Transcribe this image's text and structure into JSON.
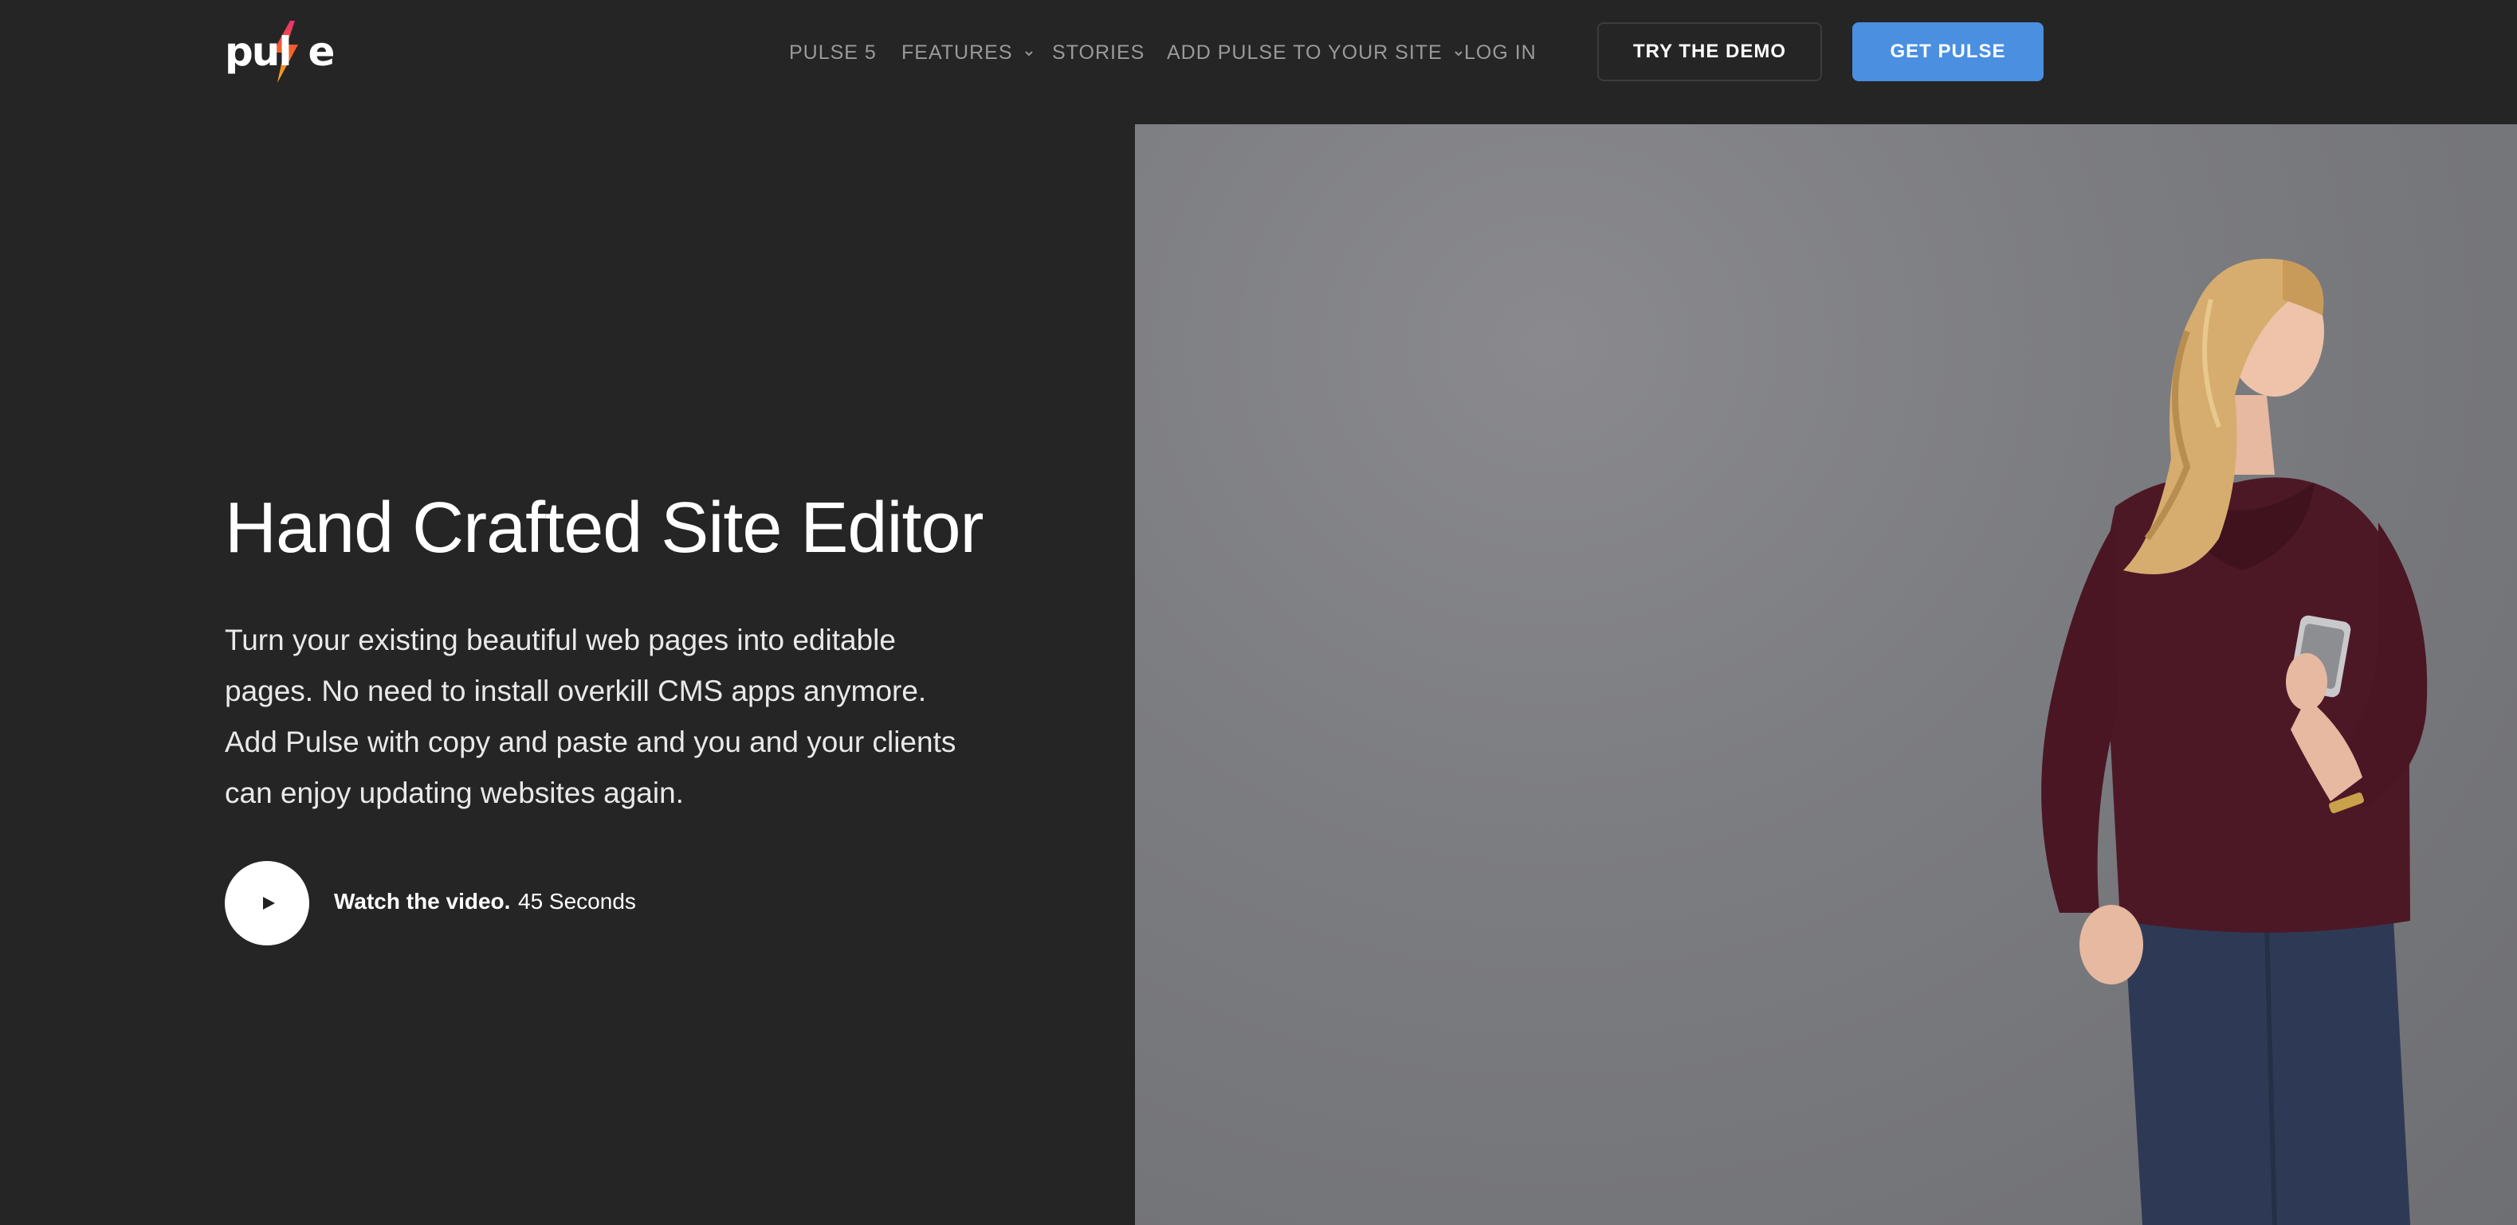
{
  "header": {
    "logo_text": "pulse",
    "nav": [
      {
        "label": "PULSE 5",
        "has_dropdown": false
      },
      {
        "label": "FEATURES",
        "has_dropdown": true
      },
      {
        "label": "STORIES",
        "has_dropdown": false
      },
      {
        "label": "ADD PULSE TO YOUR SITE",
        "has_dropdown": true
      },
      {
        "label": "LOG IN",
        "has_dropdown": false
      }
    ],
    "try_demo_label": "TRY THE DEMO",
    "get_pulse_label": "GET PULSE"
  },
  "hero": {
    "title": "Hand Crafted Site Editor",
    "description": "Turn your existing beautiful web pages into editable pages. No need to install overkill CMS apps anymore. Add Pulse with copy and paste and you and your clients can enjoy updating websites again.",
    "watch_label": "Watch the video.",
    "duration": "45 Seconds",
    "play_icon": "play-icon"
  },
  "colors": {
    "background": "#252525",
    "accent": "#4a8fe0",
    "nav_text": "#9a9a9a",
    "logo_bolt": "#f05a28"
  }
}
